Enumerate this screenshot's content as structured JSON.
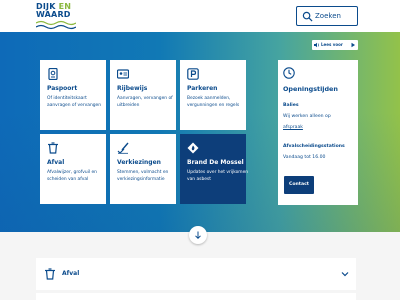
{
  "header": {
    "logo_line1_a": "DIJK",
    "logo_line1_b": "EN",
    "logo_line2": "WAARD",
    "search_placeholder": "Zoeken"
  },
  "readspeaker": {
    "label": "Lees voor"
  },
  "tiles": [
    {
      "title": "Paspoort",
      "desc": "Of identiteitskaart aanvragen of vervangen",
      "icon": "passport-icon"
    },
    {
      "title": "Rijbewijs",
      "desc": "Aanvragen, vervangen of uitbreiden",
      "icon": "id-card-icon"
    },
    {
      "title": "Parkeren",
      "desc": "Bezoek aanmelden, vergunningen en regels",
      "icon": "parking-icon"
    },
    {
      "title": "Afval",
      "desc": "Afvalwijzer, grofvuil en scheiden van afval",
      "icon": "waste-bin-icon"
    },
    {
      "title": "Verkiezingen",
      "desc": "Stemmen, volmacht en verkiezingsinformatie",
      "icon": "ballot-icon"
    },
    {
      "title": "Brand De Mossel",
      "desc": "Updates over het vrijkomen van asbest",
      "icon": "flame-icon"
    }
  ],
  "hours": {
    "title": "Openingstijden",
    "balies_label": "Balies",
    "balies_text": "Wij werken alleen op",
    "balies_link": "afspraak",
    "afval_label": "Afvalscheidingsstations",
    "afval_text": "Vandaag tot 16.00",
    "contact_label": "Contact"
  },
  "accordion": [
    {
      "label": "Afval",
      "icon": "waste-bin-icon"
    }
  ],
  "colors": {
    "brand_blue": "#0b4b8c",
    "dark_tile": "#0d3e7a",
    "gradient_start": "#0e6ab8",
    "gradient_end": "#93c24a"
  }
}
